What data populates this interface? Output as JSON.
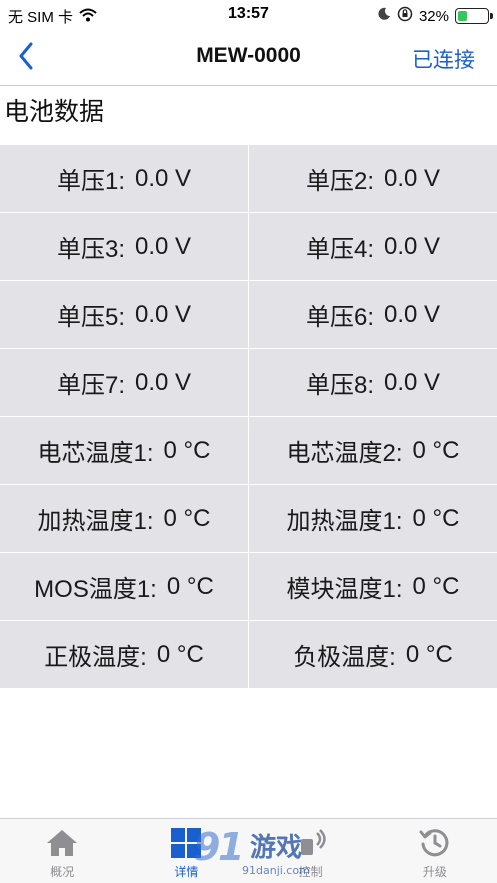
{
  "status_bar": {
    "carrier": "无 SIM 卡",
    "time": "13:57",
    "battery_percent_text": "32%",
    "battery_level": 0.32,
    "icons": [
      "wifi-icon",
      "moon-icon",
      "orientation-lock-icon",
      "battery-icon"
    ]
  },
  "nav": {
    "title": "MEW-0000",
    "right_text": "已连接",
    "back_icon": "chevron-left-icon"
  },
  "section": {
    "title": "电池数据"
  },
  "grid": {
    "rows": [
      [
        {
          "label": "单压1:",
          "value": "0.0 V"
        },
        {
          "label": "单压2:",
          "value": "0.0 V"
        }
      ],
      [
        {
          "label": "单压3:",
          "value": "0.0 V"
        },
        {
          "label": "单压4:",
          "value": "0.0 V"
        }
      ],
      [
        {
          "label": "单压5:",
          "value": "0.0 V"
        },
        {
          "label": "单压6:",
          "value": "0.0 V"
        }
      ],
      [
        {
          "label": "单压7:",
          "value": "0.0 V"
        },
        {
          "label": "单压8:",
          "value": "0.0 V"
        }
      ],
      [
        {
          "label": "电芯温度1:",
          "value": "0 °C"
        },
        {
          "label": "电芯温度2:",
          "value": "0 °C"
        }
      ],
      [
        {
          "label": "加热温度1:",
          "value": "0 °C"
        },
        {
          "label": "加热温度1:",
          "value": "0 °C"
        }
      ],
      [
        {
          "label": "MOS温度1:",
          "value": "0 °C"
        },
        {
          "label": "模块温度1:",
          "value": "0 °C"
        }
      ],
      [
        {
          "label": "正极温度:",
          "value": "0 °C"
        },
        {
          "label": "负极温度:",
          "value": "0 °C"
        }
      ]
    ]
  },
  "tabs": [
    {
      "label": "概况",
      "icon": "home-icon",
      "active": false
    },
    {
      "label": "详情",
      "icon": "grid-icon",
      "active": true
    },
    {
      "label": "控制",
      "icon": "control-icon",
      "active": false
    },
    {
      "label": "升级",
      "icon": "history-icon",
      "active": false
    }
  ],
  "watermark": {
    "text": "游戏",
    "subtext": "91danji.com"
  },
  "colors": {
    "accent": "#1a5fd0",
    "grid_bg": "#e3e3e7",
    "tab_inactive": "#8e8e93",
    "battery_fill": "#34c759"
  }
}
